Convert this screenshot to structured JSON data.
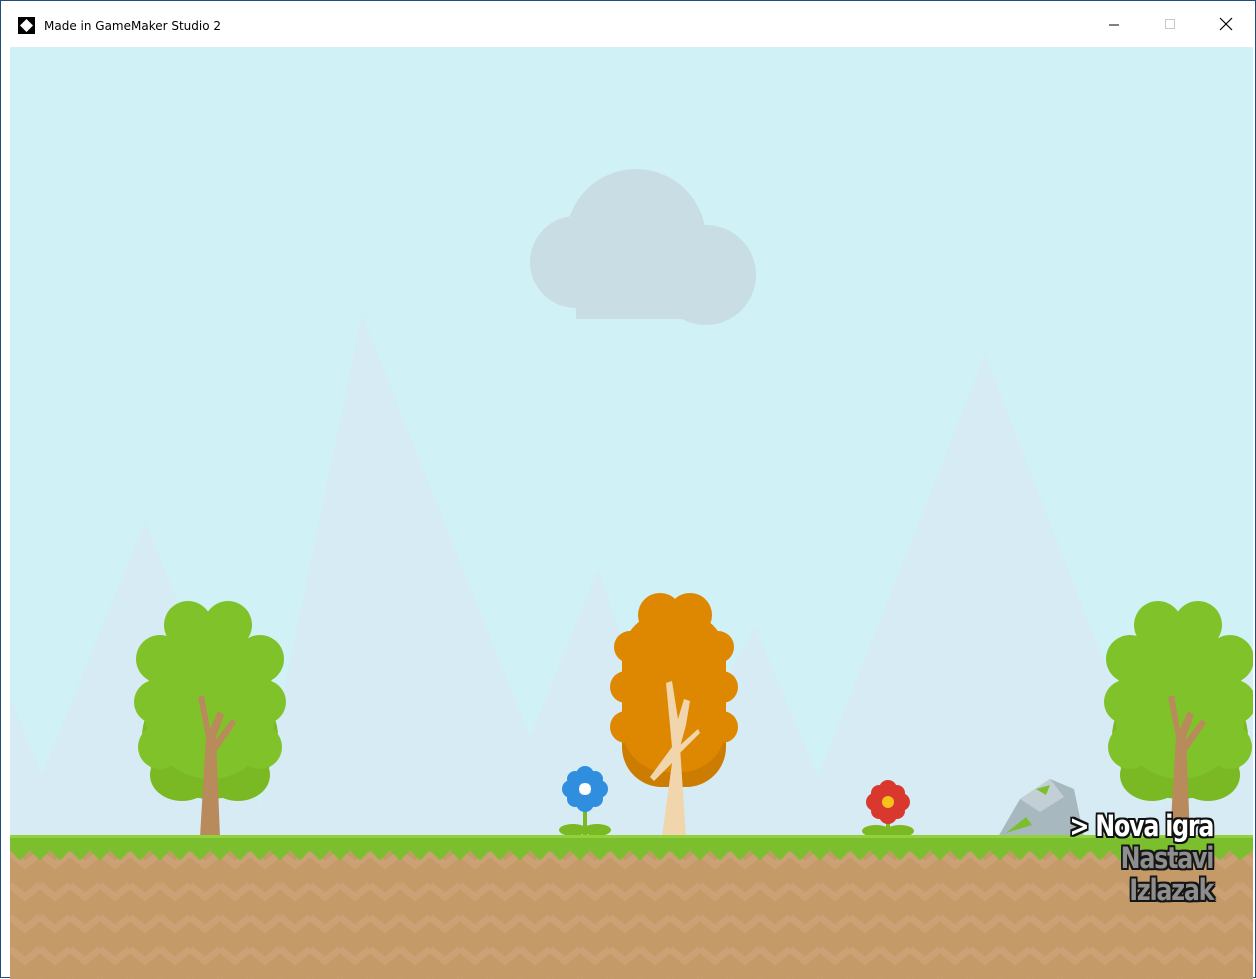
{
  "window": {
    "title": "Made in GameMaker Studio 2",
    "app_icon": "gamemaker-logo-icon",
    "controls": {
      "minimize_icon": "minimize-icon",
      "maximize_icon": "maximize-icon",
      "close_icon": "close-icon"
    }
  },
  "menu": {
    "items": [
      {
        "label": "> Nova igra",
        "selected": true
      },
      {
        "label": "Nastavi",
        "selected": false
      },
      {
        "label": "Izlazak",
        "selected": false
      }
    ]
  },
  "colors": {
    "sky": "#d0f1f6",
    "mountains": "#d6ebf3",
    "cloud": "#c8dee4",
    "grass": "#7cbf2e",
    "dirt": "#c39a68",
    "tree_green": "#80c22a",
    "tree_orange": "#dd8800",
    "trunk": "#b98a5c",
    "menu_selected": "#ffffff",
    "menu_inactive": "#8e8e8e"
  }
}
